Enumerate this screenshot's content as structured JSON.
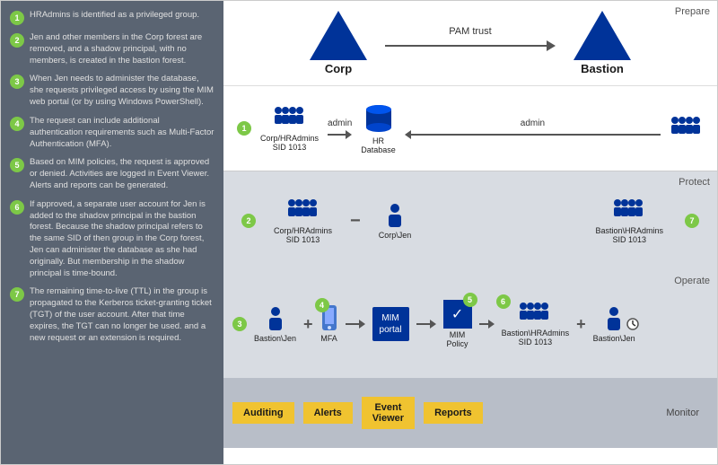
{
  "left_panel": {
    "steps": [
      {
        "num": "1",
        "text": "HRAdmins is identified as a privileged group."
      },
      {
        "num": "2",
        "text": "Jen and other members in the Corp forest are removed, and a shadow principal, with no members, is created in the bastion forest."
      },
      {
        "num": "3",
        "text": "When Jen needs to administer the database, she requests privileged access by using the MIM web portal (or by using Windows PowerShell)."
      },
      {
        "num": "4",
        "text": "The request can include additional authentication requirements such as Multi-Factor Authentication (MFA)."
      },
      {
        "num": "5",
        "text": "Based on MIM policies, the request is approved or denied. Activities are logged in Event Viewer. Alerts and reports can be generated."
      },
      {
        "num": "6",
        "text": "If approved, a separate user account for Jen is added to the shadow principal in the bastion forest. Because the shadow principal refers to the same SID of then group in the Corp forest, Jen can administer the database as she had originally. But membership in the shadow principal is time-bound."
      },
      {
        "num": "7",
        "text": "The remaining time-to-live (TTL) in the group is propagated to the Kerberos ticket-granting ticket (TGT) of the user account. After that time expires, the TGT can no longer be used. and a new request or an extension is required."
      }
    ]
  },
  "top": {
    "corp_label": "Corp",
    "bastion_label": "Bastion",
    "pam_label": "PAM trust",
    "section_label": "Prepare"
  },
  "prepare": {
    "step_num": "1",
    "group_label": "Corp/HRAdmins\nSID 1013",
    "admin_left": "admin",
    "admin_right": "admin",
    "db_label": "HR\nDatabase",
    "section_label": "Prepare"
  },
  "protect": {
    "step_num": "2",
    "corp_group_label": "Corp/HRAdmins\nSID 1013",
    "corp_jen_label": "Corp\\Jen",
    "bastion_group_label": "Bastion\\HRAdmins\nSID 1013",
    "step7_num": "7",
    "section_label": "Protect"
  },
  "operate": {
    "step3_num": "3",
    "bastion_jen_label": "Bastion\\Jen",
    "plus1": "+",
    "step4_num": "4",
    "mfa_label": "MFA",
    "arrow": "→",
    "mim_portal_line1": "MIM",
    "mim_portal_line2": "portal",
    "step5_num": "5",
    "mim_policy_label": "MIM\nPolicy",
    "step6_num": "6",
    "bastion_hr_label": "Bastion\\HRAdmins\nSID 1013",
    "plus2": "+",
    "bastion_jen2_label": "Bastion\\Jen",
    "section_label": "Operate"
  },
  "monitor": {
    "section_label": "Monitor",
    "buttons": [
      {
        "label": "Auditing"
      },
      {
        "label": "Alerts"
      },
      {
        "label": "Event\nViewer"
      },
      {
        "label": "Reports"
      }
    ]
  }
}
